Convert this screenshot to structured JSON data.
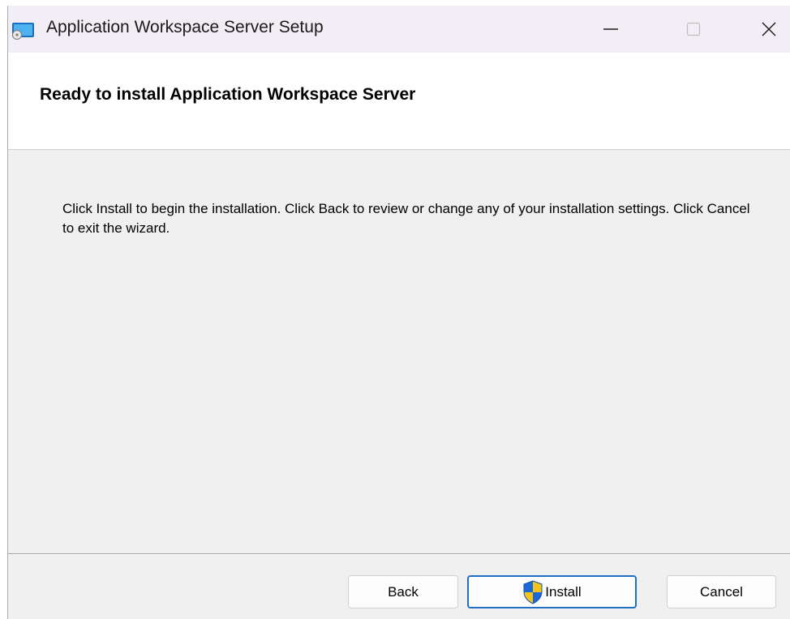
{
  "window": {
    "title": "Application Workspace Server Setup",
    "icon": "installer-app-icon"
  },
  "titlebar_controls": {
    "minimize_icon": "minimize-icon",
    "maximize_icon": "maximize-icon",
    "close_icon": "close-icon"
  },
  "header": {
    "title": "Ready to install Application Workspace Server"
  },
  "body": {
    "instructions": "Click Install to begin the installation. Click Back to review or change any of your installation settings. Click Cancel to exit the wizard."
  },
  "buttons": {
    "back_label": "Back",
    "install_label": "Install",
    "install_icon": "uac-shield-icon",
    "cancel_label": "Cancel"
  },
  "colors": {
    "titlebar_bg": "#f3eef5",
    "content_bg": "#f0f0f0",
    "header_bg": "#ffffff",
    "focus_border": "#1f6fc6",
    "shield_blue": "#1c68d6",
    "shield_yellow": "#f5c419"
  }
}
